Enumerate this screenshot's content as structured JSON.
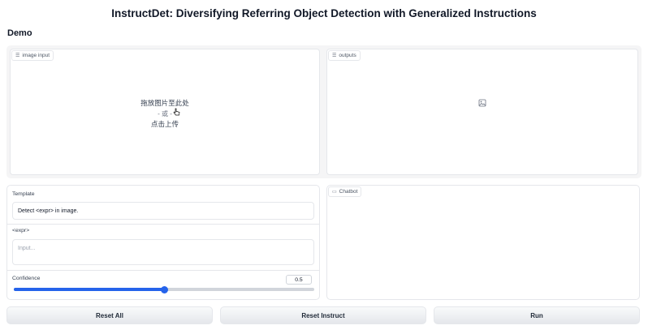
{
  "page": {
    "title": "InstructDet: Diversifying Referring Object Detection with Generalized Instructions",
    "subtitle": "Demo"
  },
  "image_input": {
    "label": "image input",
    "icon": "image-label-icon",
    "drop_text": "拖放图片至此处",
    "or_text": "- 或 -",
    "click_text": "点击上传"
  },
  "outputs": {
    "label": "outputs",
    "icon": "image-placeholder-icon"
  },
  "template": {
    "label": "Template",
    "value": "Detect <expr> in image."
  },
  "expr": {
    "label": "<expr>",
    "placeholder": "Input..."
  },
  "confidence": {
    "label": "Confidence",
    "value": "0.5",
    "fraction": 0.5
  },
  "chatbot": {
    "label": "Chatbot"
  },
  "buttons": {
    "reset_all": "Reset All",
    "reset_instruct": "Reset Instruct",
    "run": "Run"
  },
  "colors": {
    "accent": "#2563eb"
  }
}
